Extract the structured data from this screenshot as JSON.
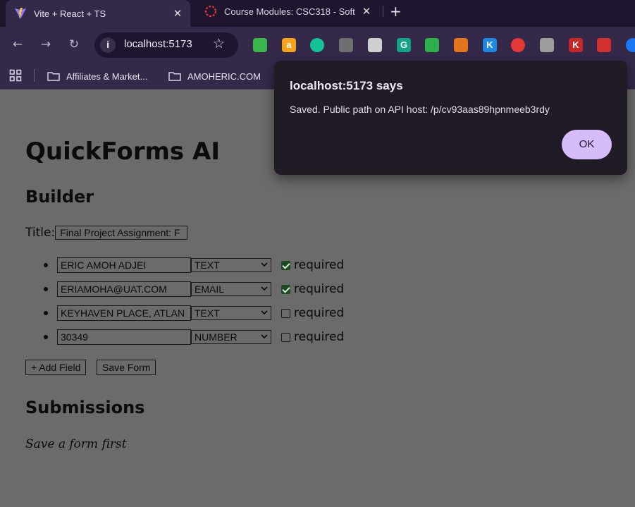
{
  "browser": {
    "tabs": [
      {
        "title": "Vite + React + TS",
        "close": "✕",
        "icon": "vite-icon"
      },
      {
        "title": "Course Modules: CSC318 - Soft",
        "close": "✕",
        "icon": "canvas-icon"
      }
    ],
    "new_tab": "+",
    "nav": {
      "back": "←",
      "forward": "→",
      "reload": "↻"
    },
    "address": {
      "url": "localhost:5173",
      "info": "i",
      "star": "☆"
    },
    "extensions": [
      {
        "name": "clipboard-extension-icon",
        "label": "",
        "color": "#39b54a"
      },
      {
        "name": "amazon-assistant-icon",
        "label": "a",
        "color": "#f7a21b"
      },
      {
        "name": "grammarly-go-icon",
        "label": "",
        "color": "#15c39a"
      },
      {
        "name": "web-extension-icon",
        "label": "",
        "color": "#6f6f6f"
      },
      {
        "name": "restaurant-extension-icon",
        "label": "",
        "color": "#cfcfcf"
      },
      {
        "name": "grammarly-icon",
        "label": "G",
        "color": "#11a683"
      },
      {
        "name": "robot-extension-icon",
        "label": "",
        "color": "#2eb14d"
      },
      {
        "name": "metamask-icon",
        "label": "",
        "color": "#e2761b"
      },
      {
        "name": "k-extension-icon",
        "label": "K",
        "color": "#1e88e5"
      },
      {
        "name": "pokeball-icon",
        "label": "",
        "color": "#e53935"
      },
      {
        "name": "loading-spinner-icon",
        "label": "",
        "color": "#9e9e9e"
      },
      {
        "name": "k-red-extension-icon",
        "label": "K",
        "color": "#c62828"
      },
      {
        "name": "pin-extension-icon",
        "label": "",
        "color": "#d32f2f"
      },
      {
        "name": "messenger-icon",
        "label": "",
        "color": "#1877f2"
      }
    ],
    "bookmarks": [
      {
        "label": "Affiliates & Market..."
      },
      {
        "label": "AMOHERIC.COM"
      }
    ]
  },
  "page": {
    "app_title": "QuickForms AI",
    "builder_heading": "Builder",
    "title_label": "Title:",
    "title_value": "Final Project Assignment: F",
    "fields": [
      {
        "value": "ERIC AMOH ADJEI",
        "type": "TEXT",
        "required": true,
        "required_label": "required"
      },
      {
        "value": "ERIAMOHA@UAT.COM",
        "type": "EMAIL",
        "required": true,
        "required_label": "required"
      },
      {
        "value": "KEYHAVEN PLACE, ATLAN",
        "type": "TEXT",
        "required": false,
        "required_label": "required"
      },
      {
        "value": "30349",
        "type": "NUMBER",
        "required": false,
        "required_label": "required"
      }
    ],
    "add_field_label": "+ Add Field",
    "save_form_label": "Save Form",
    "submissions_heading": "Submissions",
    "submissions_empty": "Save a form first"
  },
  "dialog": {
    "title": "localhost:5173 says",
    "message": "Saved. Public path on API host: /p/cv93aas89hpnmeeb3rdy",
    "ok_label": "OK"
  }
}
